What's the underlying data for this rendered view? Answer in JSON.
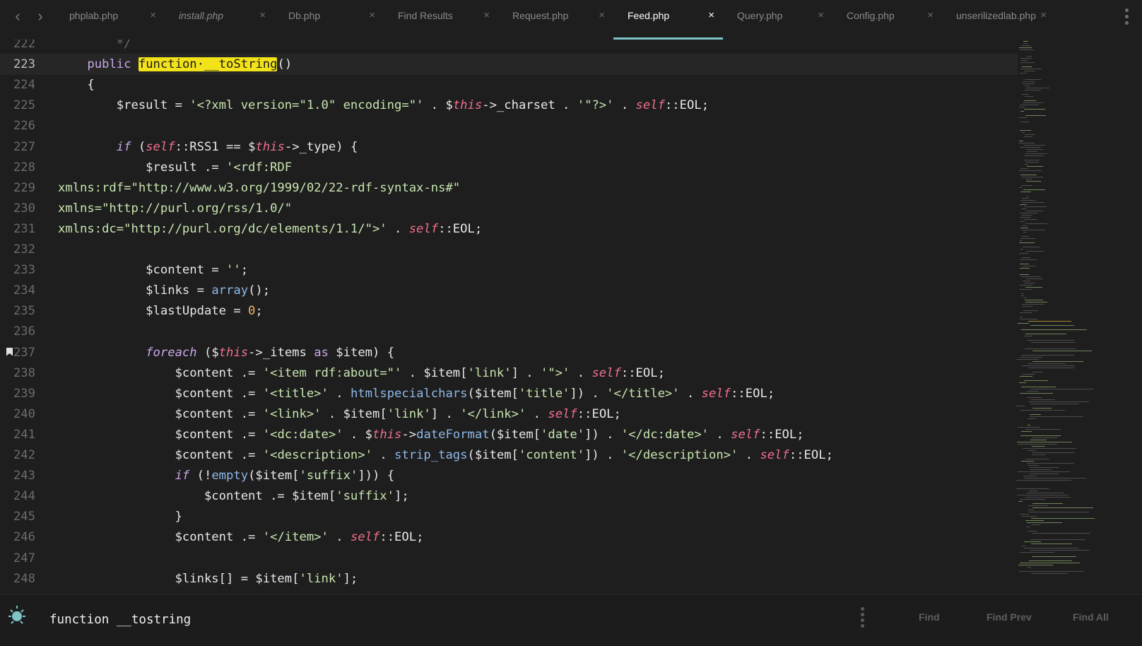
{
  "tabs": [
    {
      "label": "phplab.php",
      "italic": false,
      "active": false
    },
    {
      "label": "install.php",
      "italic": true,
      "active": false
    },
    {
      "label": "Db.php",
      "italic": false,
      "active": false
    },
    {
      "label": "Find Results",
      "italic": false,
      "active": false
    },
    {
      "label": "Request.php",
      "italic": false,
      "active": false
    },
    {
      "label": "Feed.php",
      "italic": false,
      "active": true
    },
    {
      "label": "Query.php",
      "italic": false,
      "active": false
    },
    {
      "label": "Config.php",
      "italic": false,
      "active": false
    },
    {
      "label": "unserilizedlab.php",
      "italic": false,
      "active": false
    }
  ],
  "tab_close_glyph": "×",
  "nav": {
    "back_glyph": "‹",
    "forward_glyph": "›"
  },
  "editor": {
    "current_line": 223,
    "bookmark_line": 237,
    "lines": [
      {
        "n": 222,
        "tokens": [
          [
            "cm",
            "        */"
          ]
        ]
      },
      {
        "n": 223,
        "tokens": [
          [
            "",
            "    "
          ],
          [
            "kw",
            "public"
          ],
          [
            "",
            " "
          ],
          [
            "hl",
            "function·__toString"
          ],
          [
            "",
            "()"
          ]
        ]
      },
      {
        "n": 224,
        "tokens": [
          [
            "",
            "    {"
          ]
        ]
      },
      {
        "n": 225,
        "tokens": [
          [
            "",
            "        $result = "
          ],
          [
            "str",
            "'<?xml version=\"1.0\" encoding=\"'"
          ],
          [
            "",
            " . $"
          ],
          [
            "self",
            "this"
          ],
          [
            "",
            "->_charset . "
          ],
          [
            "str",
            "'\"?>'"
          ],
          [
            "",
            " . "
          ],
          [
            "self",
            "self"
          ],
          [
            "",
            "::EOL;"
          ]
        ]
      },
      {
        "n": 226,
        "tokens": []
      },
      {
        "n": 227,
        "tokens": [
          [
            "",
            "        "
          ],
          [
            "kwi",
            "if"
          ],
          [
            "",
            " ("
          ],
          [
            "self",
            "self"
          ],
          [
            "",
            "::RSS1 == $"
          ],
          [
            "self",
            "this"
          ],
          [
            "",
            "->_type) {"
          ]
        ]
      },
      {
        "n": 228,
        "tokens": [
          [
            "",
            "            $result .= "
          ],
          [
            "str",
            "'<rdf:RDF"
          ]
        ]
      },
      {
        "n": 229,
        "tokens": [
          [
            "str",
            "xmlns:rdf=\"http://www.w3.org/1999/02/22-rdf-syntax-ns#\""
          ]
        ]
      },
      {
        "n": 230,
        "tokens": [
          [
            "str",
            "xmlns=\"http://purl.org/rss/1.0/\""
          ]
        ]
      },
      {
        "n": 231,
        "tokens": [
          [
            "str",
            "xmlns:dc=\"http://purl.org/dc/elements/1.1/\">'"
          ],
          [
            "",
            " . "
          ],
          [
            "self",
            "self"
          ],
          [
            "",
            "::EOL;"
          ]
        ]
      },
      {
        "n": 232,
        "tokens": []
      },
      {
        "n": 233,
        "tokens": [
          [
            "",
            "            $content = "
          ],
          [
            "str",
            "''"
          ],
          [
            "",
            ";"
          ]
        ]
      },
      {
        "n": 234,
        "tokens": [
          [
            "",
            "            $links = "
          ],
          [
            "fn",
            "array"
          ],
          [
            "",
            "();"
          ]
        ]
      },
      {
        "n": 235,
        "tokens": [
          [
            "",
            "            $lastUpdate = "
          ],
          [
            "num",
            "0"
          ],
          [
            "",
            ";"
          ]
        ]
      },
      {
        "n": 236,
        "tokens": []
      },
      {
        "n": 237,
        "tokens": [
          [
            "",
            "            "
          ],
          [
            "kwi",
            "foreach"
          ],
          [
            "",
            " ($"
          ],
          [
            "self",
            "this"
          ],
          [
            "",
            "->_items "
          ],
          [
            "kw",
            "as"
          ],
          [
            "",
            " $item) {"
          ]
        ]
      },
      {
        "n": 238,
        "tokens": [
          [
            "",
            "                $content .= "
          ],
          [
            "str",
            "'<item rdf:about=\"'"
          ],
          [
            "",
            " . $item["
          ],
          [
            "str",
            "'link'"
          ],
          [
            "",
            "] . "
          ],
          [
            "str",
            "'\">'"
          ],
          [
            "",
            " . "
          ],
          [
            "self",
            "self"
          ],
          [
            "",
            "::EOL;"
          ]
        ]
      },
      {
        "n": 239,
        "tokens": [
          [
            "",
            "                $content .= "
          ],
          [
            "str",
            "'<title>'"
          ],
          [
            "",
            " . "
          ],
          [
            "fn",
            "htmlspecialchars"
          ],
          [
            "",
            "($item["
          ],
          [
            "str",
            "'title'"
          ],
          [
            "",
            "]) . "
          ],
          [
            "str",
            "'</title>'"
          ],
          [
            "",
            " . "
          ],
          [
            "self",
            "self"
          ],
          [
            "",
            "::EOL;"
          ]
        ]
      },
      {
        "n": 240,
        "tokens": [
          [
            "",
            "                $content .= "
          ],
          [
            "str",
            "'<link>'"
          ],
          [
            "",
            " . $item["
          ],
          [
            "str",
            "'link'"
          ],
          [
            "",
            "] . "
          ],
          [
            "str",
            "'</link>'"
          ],
          [
            "",
            " . "
          ],
          [
            "self",
            "self"
          ],
          [
            "",
            "::EOL;"
          ]
        ]
      },
      {
        "n": 241,
        "tokens": [
          [
            "",
            "                $content .= "
          ],
          [
            "str",
            "'<dc:date>'"
          ],
          [
            "",
            " . $"
          ],
          [
            "self",
            "this"
          ],
          [
            "",
            "->"
          ],
          [
            "fn",
            "dateFormat"
          ],
          [
            "",
            "($item["
          ],
          [
            "str",
            "'date'"
          ],
          [
            "",
            "]) . "
          ],
          [
            "str",
            "'</dc:date>'"
          ],
          [
            "",
            " . "
          ],
          [
            "self",
            "self"
          ],
          [
            "",
            "::EOL;"
          ]
        ]
      },
      {
        "n": 242,
        "tokens": [
          [
            "",
            "                $content .= "
          ],
          [
            "str",
            "'<description>'"
          ],
          [
            "",
            " . "
          ],
          [
            "fn",
            "strip_tags"
          ],
          [
            "",
            "($item["
          ],
          [
            "str",
            "'content'"
          ],
          [
            "",
            "]) . "
          ],
          [
            "str",
            "'</description>'"
          ],
          [
            "",
            " . "
          ],
          [
            "self",
            "self"
          ],
          [
            "",
            "::EOL;"
          ]
        ]
      },
      {
        "n": 243,
        "tokens": [
          [
            "",
            "                "
          ],
          [
            "kwi",
            "if"
          ],
          [
            "",
            " (!"
          ],
          [
            "fn",
            "empty"
          ],
          [
            "",
            "($item["
          ],
          [
            "str",
            "'suffix'"
          ],
          [
            "",
            "])) {"
          ]
        ]
      },
      {
        "n": 244,
        "tokens": [
          [
            "",
            "                    $content .= $item["
          ],
          [
            "str",
            "'suffix'"
          ],
          [
            "",
            "];"
          ]
        ]
      },
      {
        "n": 245,
        "tokens": [
          [
            "",
            "                }"
          ]
        ]
      },
      {
        "n": 246,
        "tokens": [
          [
            "",
            "                $content .= "
          ],
          [
            "str",
            "'</item>'"
          ],
          [
            "",
            " . "
          ],
          [
            "self",
            "self"
          ],
          [
            "",
            "::EOL;"
          ]
        ]
      },
      {
        "n": 247,
        "tokens": []
      },
      {
        "n": 248,
        "tokens": [
          [
            "",
            "                $links[] = $item["
          ],
          [
            "str",
            "'link'"
          ],
          [
            "",
            "];"
          ]
        ]
      }
    ]
  },
  "find": {
    "query": "function __tostring",
    "buttons": {
      "find": "Find",
      "find_prev": "Find Prev",
      "find_all": "Find All"
    }
  },
  "colors": {
    "background": "#1e1e1e",
    "active_tab_underline": "#7ec3c5",
    "highlight": "#f2e21a",
    "find_icon": "#7ec3c5"
  }
}
